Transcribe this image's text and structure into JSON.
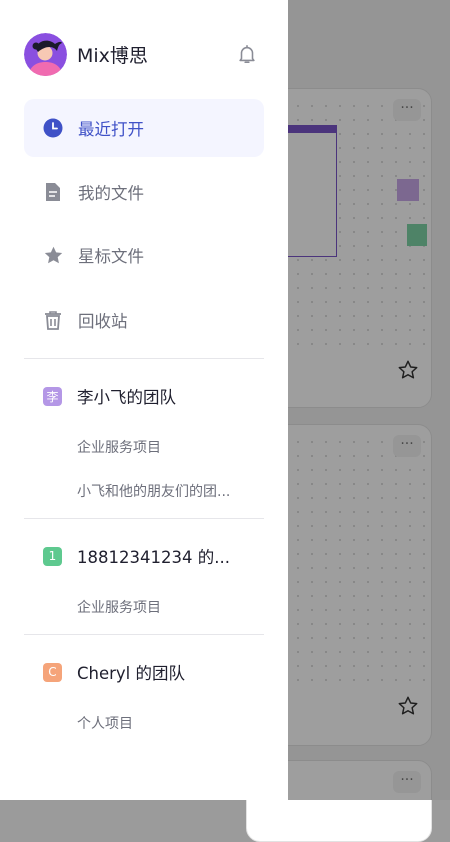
{
  "profile": {
    "name": "Mix博思",
    "avatar_icon": "user-avatar",
    "bell_icon": "bell-icon"
  },
  "nav": {
    "items": [
      {
        "label": "最近打开",
        "icon": "clock-icon",
        "active": true
      },
      {
        "label": "我的文件",
        "icon": "file-icon",
        "active": false
      },
      {
        "label": "星标文件",
        "icon": "star-icon",
        "active": false
      },
      {
        "label": "回收站",
        "icon": "trash-icon",
        "active": false
      }
    ]
  },
  "teams": [
    {
      "badge": "李",
      "badge_color": "#b497e6",
      "name": "李小飞的团队",
      "projects": [
        "企业服务项目",
        "小飞和他的朋友们的团..."
      ]
    },
    {
      "badge": "1",
      "badge_color": "#5ec98f",
      "name": "18812341234 的...",
      "projects": [
        "企业服务项目"
      ]
    },
    {
      "badge": "C",
      "badge_color": "#f5a47a",
      "name": "Cheryl 的团队",
      "projects": [
        "个人项目"
      ]
    }
  ],
  "colors": {
    "accent": "#3f51c7",
    "active_bg": "#f4f5ff"
  }
}
